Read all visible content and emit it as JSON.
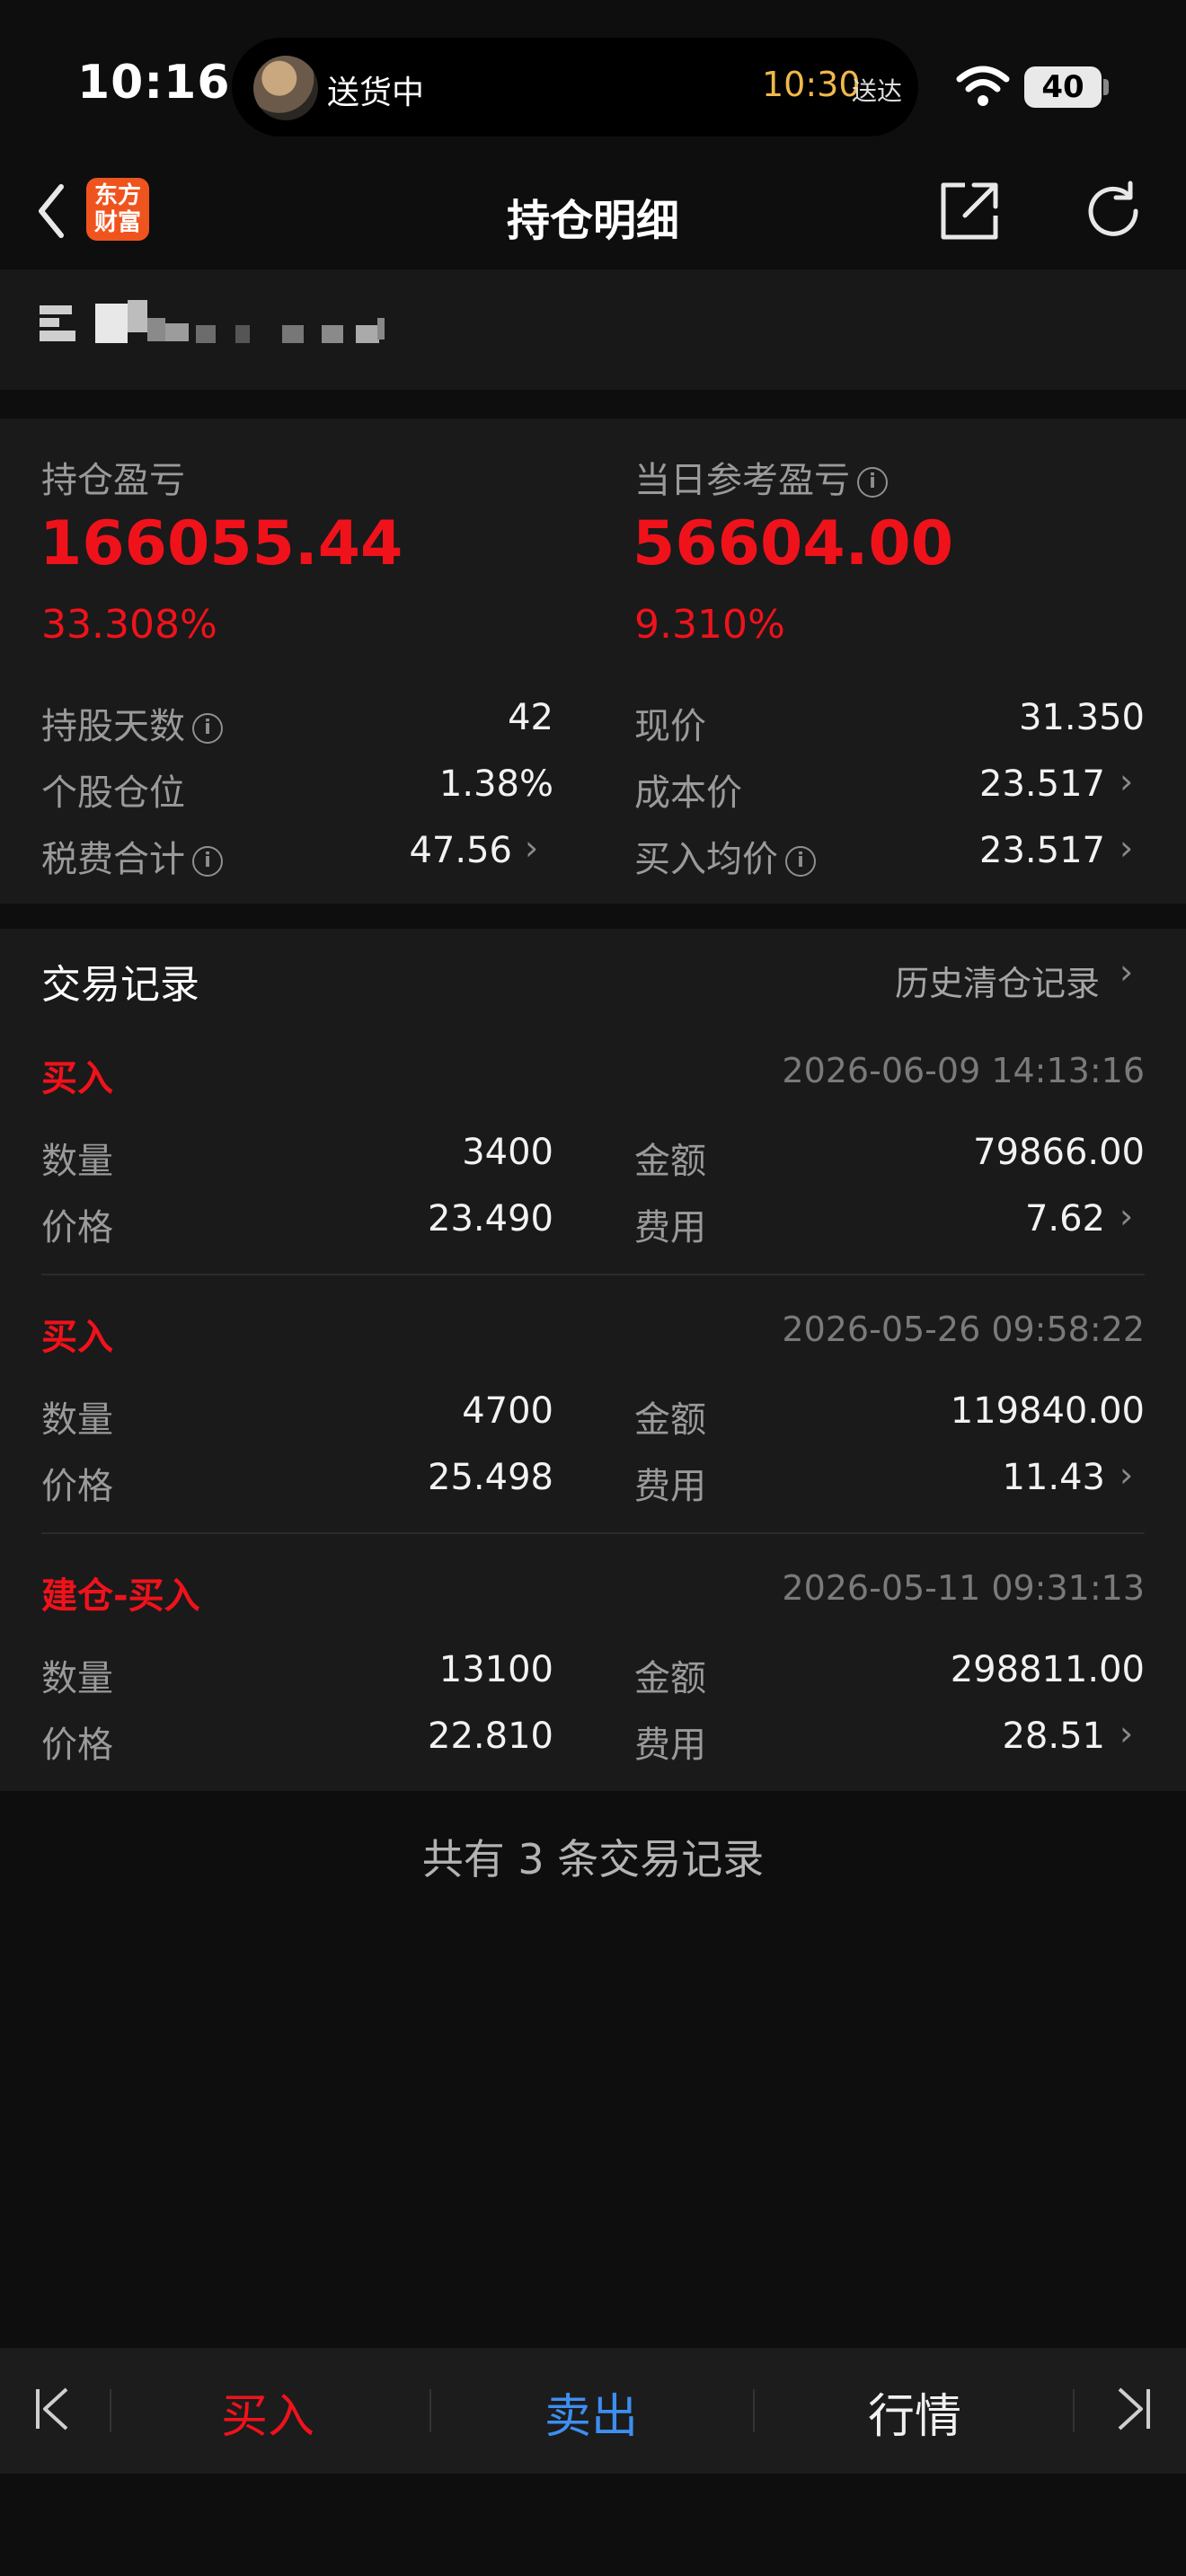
{
  "status_bar": {
    "time": "10:16",
    "live_activity_text": "送货中",
    "eta_time": "10:30",
    "eta_suffix": "送达",
    "battery": "40"
  },
  "nav": {
    "app_logo_line1": "东方",
    "app_logo_line2": "财富",
    "title": "持仓明细"
  },
  "summary": {
    "position_pl_label": "持仓盈亏",
    "position_pl_value": "166055.44",
    "position_pl_pct": "33.308%",
    "daily_pl_label": "当日参考盈亏",
    "daily_pl_value": "56604.00",
    "daily_pl_pct": "9.310%",
    "rows_left": [
      {
        "label": "持股天数",
        "value": "42",
        "info": true,
        "chevron": false
      },
      {
        "label": "个股仓位",
        "value": "1.38%",
        "info": false,
        "chevron": false
      },
      {
        "label": "税费合计",
        "value": "47.56",
        "info": true,
        "chevron": true
      }
    ],
    "rows_right": [
      {
        "label": "现价",
        "value": "31.350",
        "info": false,
        "chevron": false
      },
      {
        "label": "成本价",
        "value": "23.517",
        "info": false,
        "chevron": true
      },
      {
        "label": "买入均价",
        "value": "23.517",
        "info": true,
        "chevron": true
      }
    ]
  },
  "trades": {
    "title": "交易记录",
    "history_link": "历史清仓记录",
    "qty_label": "数量",
    "price_label": "价格",
    "amount_label": "金额",
    "fee_label": "费用",
    "records": [
      {
        "side": "买入",
        "time": "2026-06-09 14:13:16",
        "qty": "3400",
        "price": "23.490",
        "amount": "79866.00",
        "fee": "7.62"
      },
      {
        "side": "买入",
        "time": "2026-05-26 09:58:22",
        "qty": "4700",
        "price": "25.498",
        "amount": "119840.00",
        "fee": "11.43"
      },
      {
        "side": "建仓-买入",
        "time": "2026-05-11 09:31:13",
        "qty": "13100",
        "price": "22.810",
        "amount": "298811.00",
        "fee": "28.51"
      }
    ],
    "footer": "共有 3 条交易记录"
  },
  "bottom_bar": {
    "buy": "买入",
    "sell": "卖出",
    "quote": "行情"
  },
  "colors": {
    "red": "#f0121b",
    "blue": "#3d8ef0",
    "logo_orange": "#f0541e"
  }
}
